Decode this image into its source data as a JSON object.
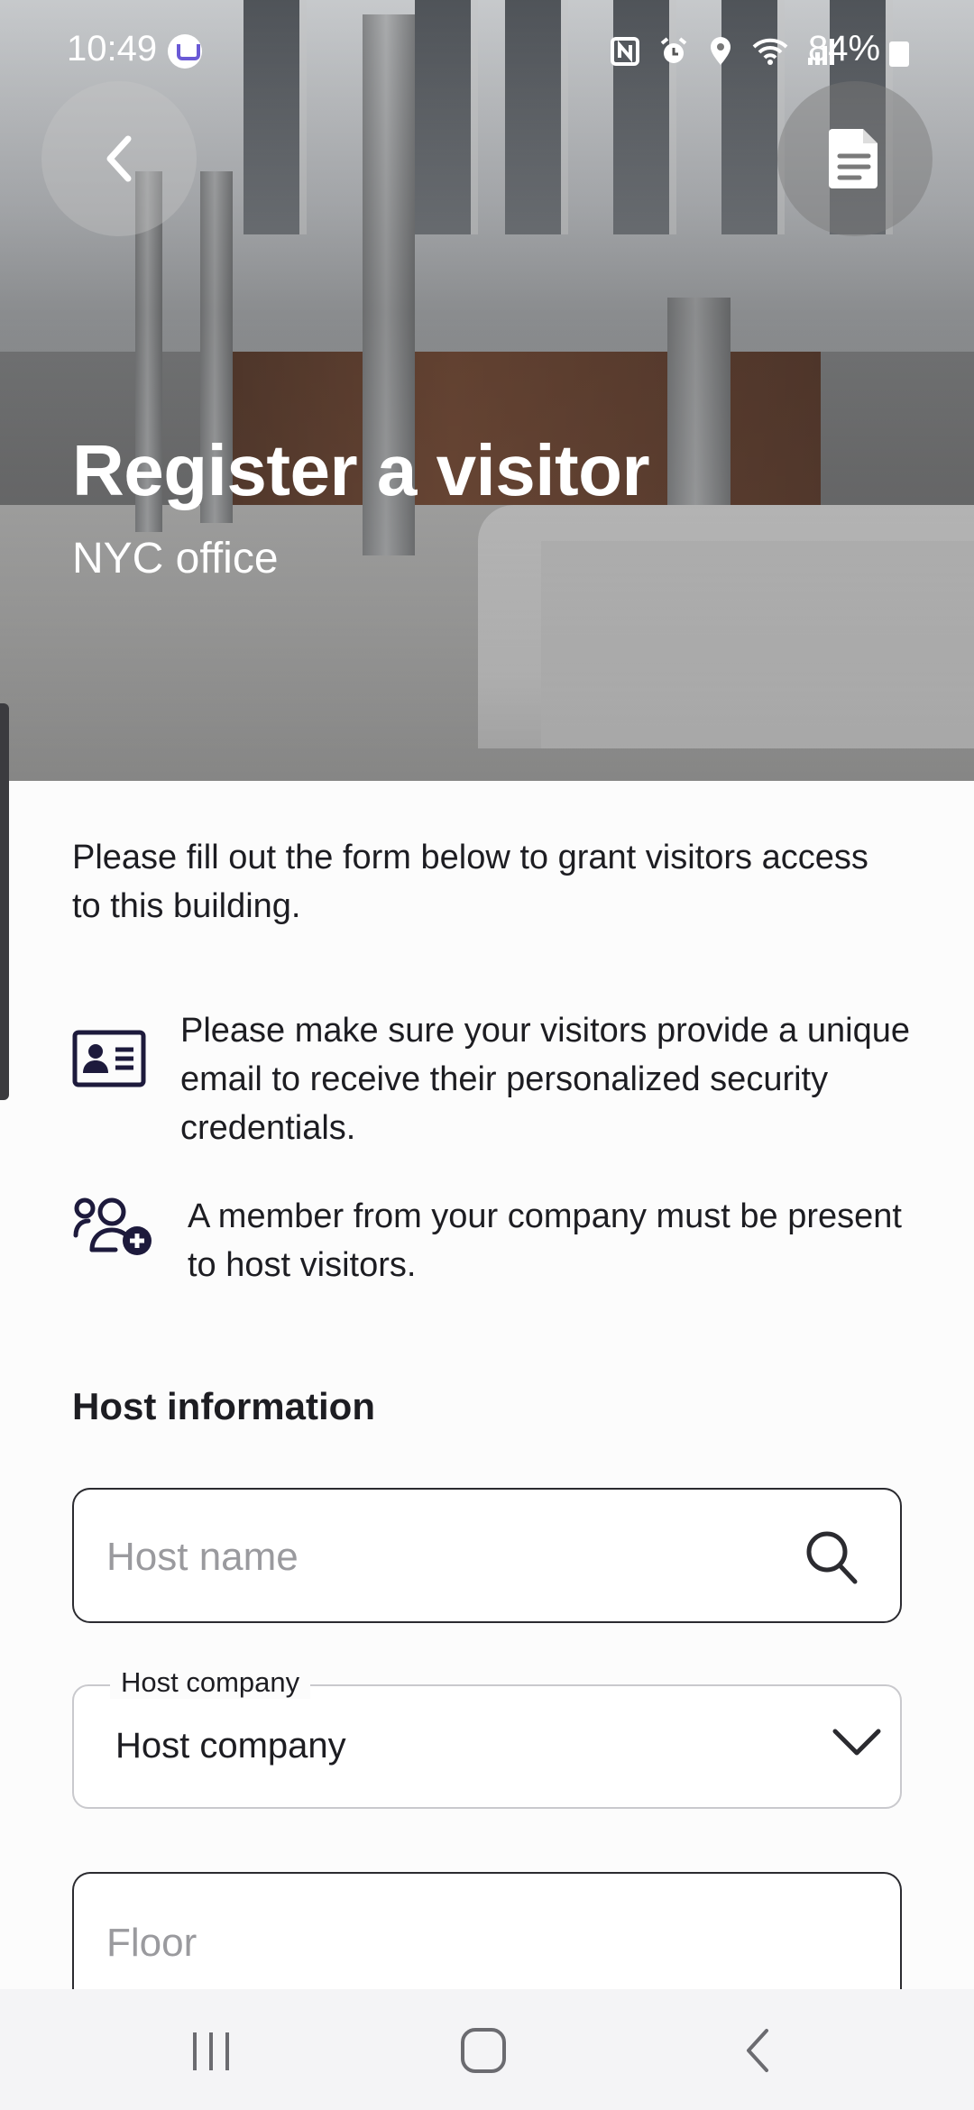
{
  "status_bar": {
    "time": "10:49",
    "battery": "84%"
  },
  "header": {
    "title": "Register a visitor",
    "subtitle": "NYC office"
  },
  "intro_text": "Please fill out the form below to grant visitors access to this building.",
  "info": [
    {
      "icon": "id-card-icon",
      "text": "Please make sure your visitors provide a unique email to receive their personalized security credentials."
    },
    {
      "icon": "add-group-icon",
      "text": "A member from your company must be present to host visitors."
    }
  ],
  "host_section": {
    "title": "Host information",
    "host_name_placeholder": "Host name",
    "host_company_label": "Host company",
    "host_company_value": "Host company",
    "floor_placeholder": "Floor"
  },
  "colors": {
    "accent": "#1d1a3c",
    "text": "#1d1d22",
    "placeholder": "#9a9a9e"
  }
}
